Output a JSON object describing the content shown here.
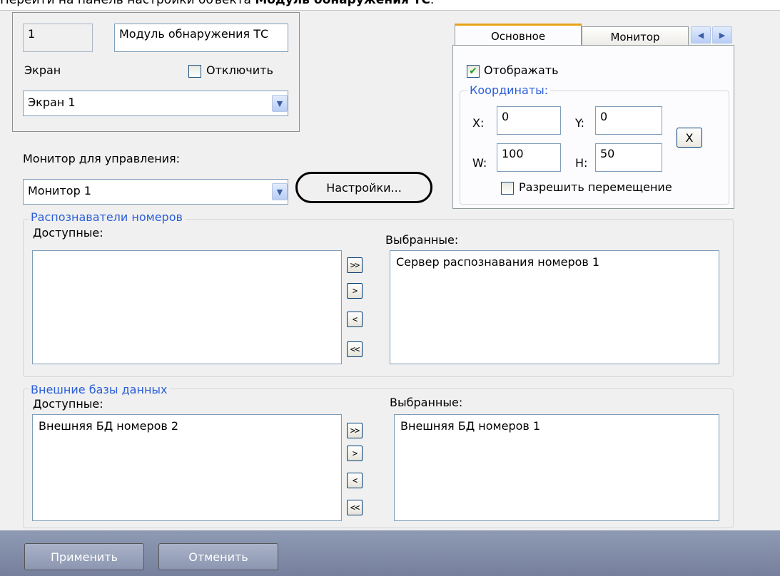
{
  "caption": {
    "prefix": "Перейти на панель настройки объекта ",
    "bold": "Модуль обнаружения ТС",
    "suffix": "."
  },
  "object": {
    "id_value": "1",
    "name_value": "Модуль обнаружения ТС",
    "screen_label": "Экран",
    "disable_label": "Отключить",
    "disable_checked": false,
    "screen_select": "Экран 1"
  },
  "monitor": {
    "label": "Монитор для управления:",
    "select": "Монитор 1",
    "settings_button": "Настройки..."
  },
  "tabs": {
    "main": "Основное",
    "monitor": "Монитор",
    "active": "main"
  },
  "display": {
    "show_label": "Отображать",
    "show_checked": true,
    "coords_title": "Координаты:",
    "x_label": "X:",
    "x_value": "0",
    "y_label": "Y:",
    "y_value": "0",
    "w_label": "W:",
    "w_value": "100",
    "h_label": "H:",
    "h_value": "50",
    "reset_button": "X",
    "allow_move_label": "Разрешить перемещение",
    "allow_move_checked": false
  },
  "recognizers": {
    "title": "Распознаватели номеров",
    "available_label": "Доступные:",
    "selected_label": "Выбранные:",
    "available": [],
    "selected": [
      "Сервер распознавания номеров 1"
    ]
  },
  "databases": {
    "title": "Внешние базы данных",
    "available_label": "Доступные:",
    "selected_label": "Выбранные:",
    "available": [
      "Внешняя БД номеров 2"
    ],
    "selected": [
      "Внешняя БД номеров 1"
    ]
  },
  "transfer": {
    "add_all": ">>",
    "add": ">",
    "remove": "<",
    "remove_all": "<<"
  },
  "footer": {
    "apply": "Применить",
    "cancel": "Отменить"
  },
  "icons": {
    "dropdown": "chevron-down-icon",
    "checkmark": "checkmark-icon",
    "tab_scroll": "arrow-left-right-icon"
  }
}
